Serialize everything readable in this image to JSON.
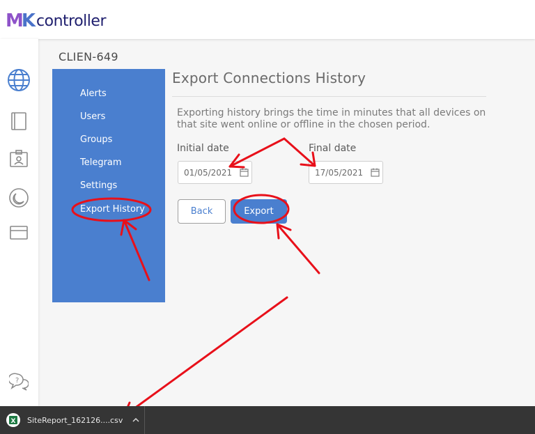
{
  "header": {
    "logo_mark": "MK",
    "logo_text": "controller"
  },
  "rail": {
    "icons": [
      "globe-icon",
      "document-icon",
      "id-badge-icon",
      "moon-icon",
      "card-icon",
      "help-chat-icon"
    ]
  },
  "site_title": "CLIEN-649",
  "menu": {
    "items": [
      {
        "label": "Alerts"
      },
      {
        "label": "Users"
      },
      {
        "label": "Groups"
      },
      {
        "label": "Telegram"
      },
      {
        "label": "Settings"
      },
      {
        "label": "Export History"
      }
    ]
  },
  "main": {
    "title": "Export Connections History",
    "description": "Exporting history brings the time in minutes that all devices on that site went online or offline in the chosen period.",
    "initial_date_label": "Initial date",
    "initial_date_value": "01/05/2021",
    "final_date_label": "Final date",
    "final_date_value": "17/05/2021",
    "back_label": "Back",
    "export_label": "Export"
  },
  "download_bar": {
    "file_name": "SiteReport_162126....csv",
    "file_icon": "excel-icon",
    "chevron_icon": "chevron-up-icon"
  },
  "colors": {
    "accent": "#4a7fcf",
    "annotation": "#e8101a",
    "download_bar": "#353535"
  }
}
